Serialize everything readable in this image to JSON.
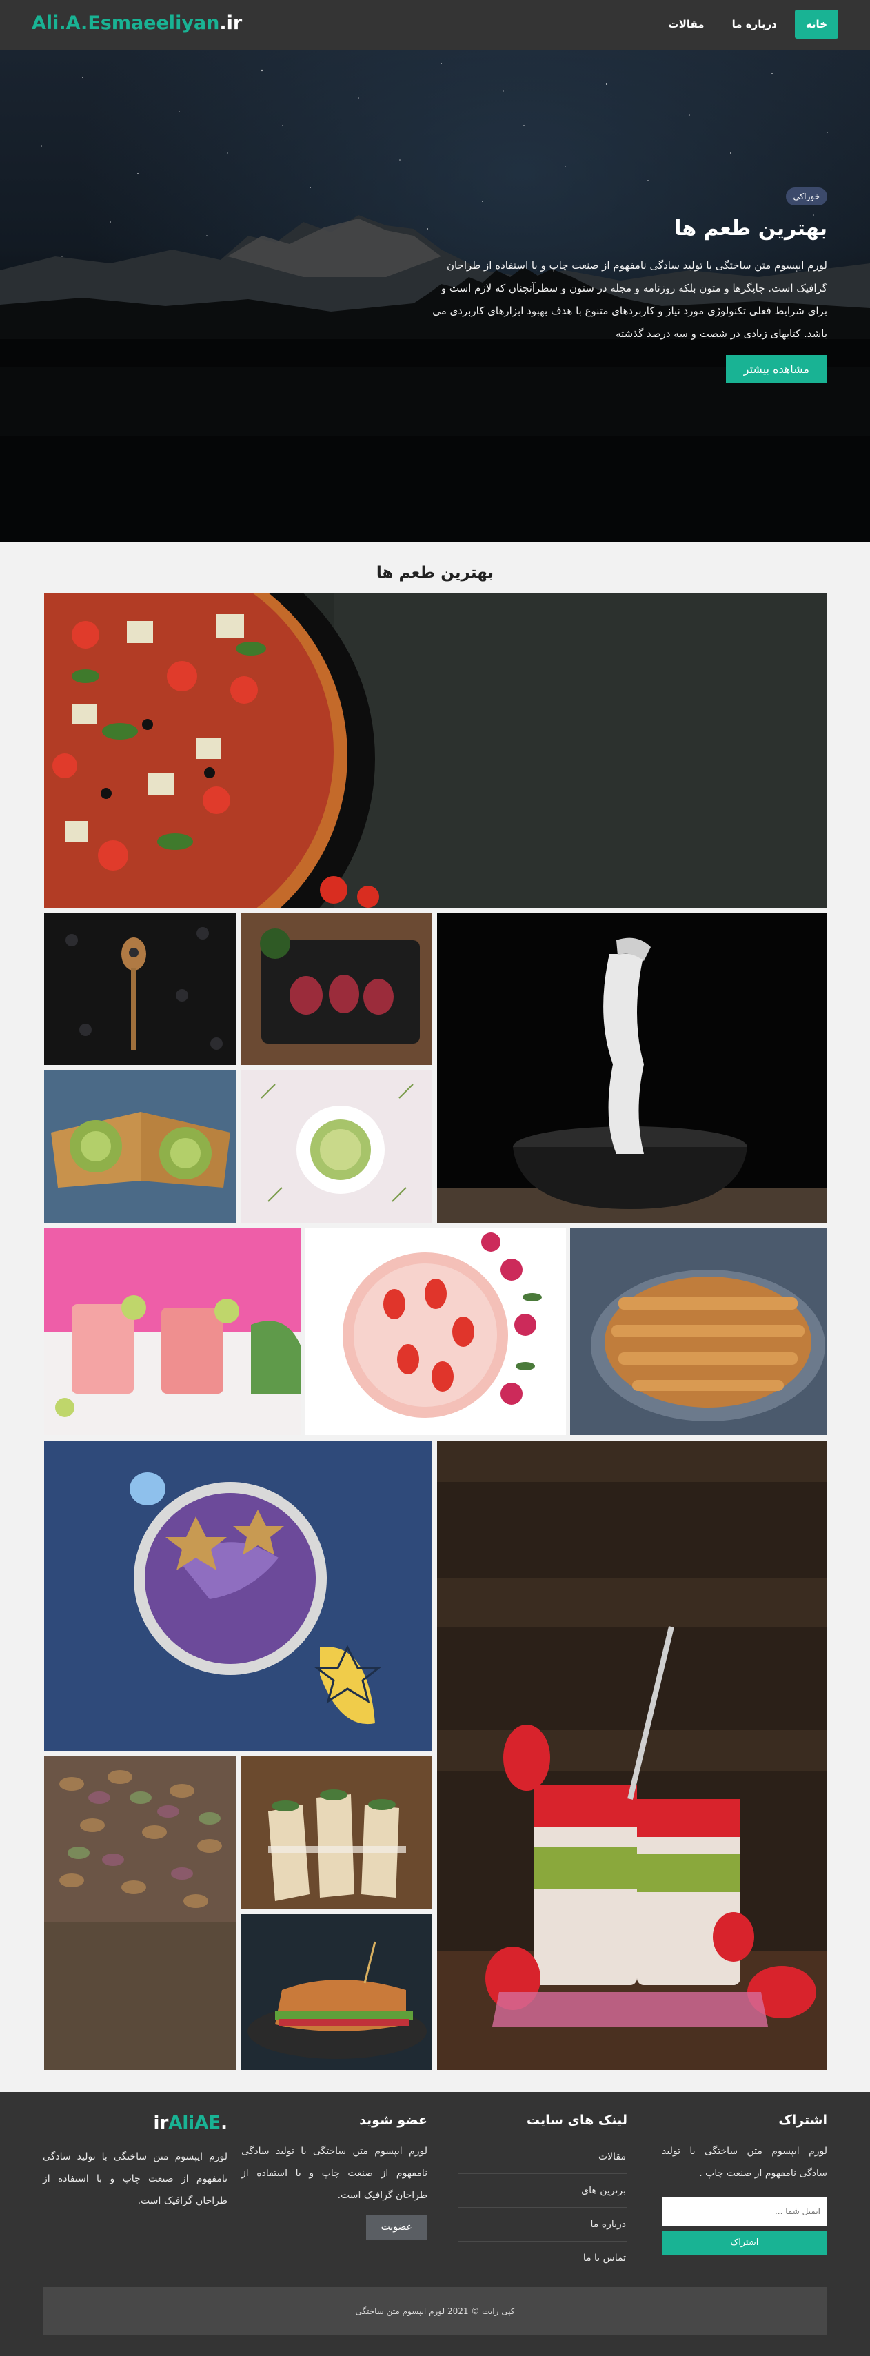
{
  "nav": {
    "brand_name": "Ali.A.Esmaeeliyan",
    "brand_tld": ".ir",
    "links": [
      {
        "label": "خانه",
        "active": true
      },
      {
        "label": "درباره ما",
        "active": false
      },
      {
        "label": "مقالات",
        "active": false
      }
    ]
  },
  "hero": {
    "badge": "خوراکی",
    "title": "بهترین طعم ها",
    "text": "لورم ایپسوم متن ساختگی با تولید سادگی نامفهوم از صنعت چاپ و با استفاده از طراحان گرافیک است. چاپگرها و متون بلکه روزنامه و مجله در ستون و سطرآنچنان که لازم است و برای شرایط فعلی تکنولوژی مورد نیاز و کاربردهای متنوع با هدف بهبود ابزارهای کاربردی می باشد. کتابهای زیادی در شصت و سه درصد گذشته",
    "button": "مشاهده بیشتر"
  },
  "gallery": {
    "title": "بهترین طعم ها",
    "images": [
      "pizza",
      "blackberries-spoon",
      "raw-meat",
      "noodles-bowl",
      "avocado-toast",
      "zucchini-pasta",
      "pink-smoothie",
      "strawberry-bowl",
      "apple-pie",
      "purple-smoothie-bowl",
      "strawberry-kiwi-dessert",
      "fusilli-pasta",
      "wraps",
      "sandwich"
    ]
  },
  "footer": {
    "subscribe": {
      "title": "اشتراک",
      "text": "لورم ایپسوم متن ساختگی با تولید سادگی نامفهوم از صنعت چاپ .",
      "placeholder": "ایمیل شما ...",
      "button": "اشتراک"
    },
    "links": {
      "title": "لینک های سایت",
      "items": [
        "مقالات",
        "برترین های",
        "درباره ما",
        "تماس با ما"
      ]
    },
    "join": {
      "title": "عضو شوید",
      "text": "لورم ایپسوم متن ساختگی با تولید سادگی نامفهوم از صنعت چاپ و با استفاده از طراحان گرافیک است.",
      "button": "عضویت"
    },
    "about": {
      "logo_name": "AliAE",
      "logo_tld": ".ir",
      "text": "لورم ایپسوم متن ساختگی با تولید سادگی نامفهوم از صنعت چاپ و با استفاده از طراحان گرافیک است."
    },
    "copyright": "کپی رایت © 2021 لورم ایپسوم متن ساختگی"
  },
  "colors": {
    "accent": "#19b394",
    "nav_bg": "#343434",
    "footer_bg": "#343434",
    "page_bg": "#f2f2f2"
  }
}
